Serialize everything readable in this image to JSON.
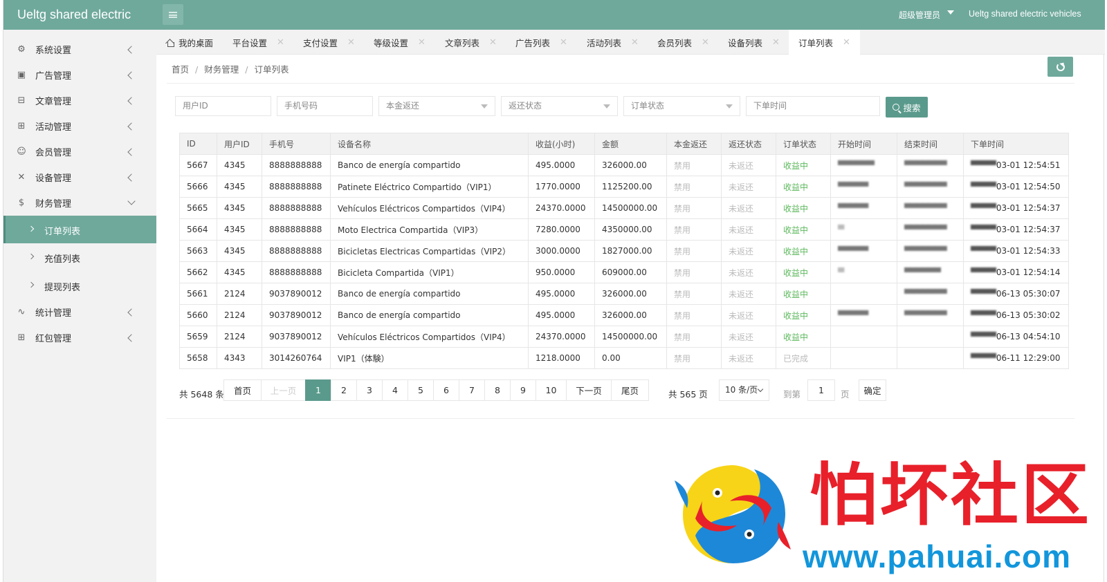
{
  "header": {
    "brand": "Ueltg shared electric",
    "admin": "超级管理员",
    "app_name": "Ueltg shared electric vehicles"
  },
  "sidebar": {
    "items": [
      {
        "label": "系统设置",
        "icon": "gear-icon"
      },
      {
        "label": "广告管理",
        "icon": "image-icon"
      },
      {
        "label": "文章管理",
        "icon": "book-icon"
      },
      {
        "label": "活动管理",
        "icon": "gift-icon"
      },
      {
        "label": "会员管理",
        "icon": "user-icon"
      },
      {
        "label": "设备管理",
        "icon": "tools-icon"
      },
      {
        "label": "财务管理",
        "icon": "dollar-icon"
      },
      {
        "label": "统计管理",
        "icon": "pulse-icon"
      },
      {
        "label": "红包管理",
        "icon": "gift-icon"
      }
    ],
    "finance_sub": [
      {
        "label": "订单列表"
      },
      {
        "label": "充值列表"
      },
      {
        "label": "提现列表"
      }
    ]
  },
  "tabs": [
    {
      "label": "我的桌面"
    },
    {
      "label": "平台设置"
    },
    {
      "label": "支付设置"
    },
    {
      "label": "等级设置"
    },
    {
      "label": "文章列表"
    },
    {
      "label": "广告列表"
    },
    {
      "label": "活动列表"
    },
    {
      "label": "会员列表"
    },
    {
      "label": "设备列表"
    },
    {
      "label": "订单列表"
    }
  ],
  "breadcrumb": [
    "首页",
    "财务管理",
    "订单列表"
  ],
  "filters": {
    "user_id": "用户ID",
    "phone": "手机号码",
    "principal_return": "本金返还",
    "return_status": "返还状态",
    "order_status": "订单状态",
    "order_time": "下单时间",
    "search_label": "搜索"
  },
  "table": {
    "columns": [
      "ID",
      "用户ID",
      "手机号",
      "设备名称",
      "收益(小时)",
      "金额",
      "本金返还",
      "返还状态",
      "订单状态",
      "开始时间",
      "结束时间",
      "下单时间"
    ],
    "rows": [
      {
        "id": "5667",
        "uid": "4345",
        "phone": "8888888888",
        "device": "Banco de energía compartido",
        "income": "495.0000",
        "amount": "326000.00",
        "principal": "禁用",
        "ret": "未返还",
        "status": "收益中",
        "start": "▀▀▀▀▀▀",
        "end": "▀▀▀▀▀▀▀",
        "ordered_mask": "▀▀▀▀",
        "ordered": "03-01 12:54:51"
      },
      {
        "id": "5666",
        "uid": "4345",
        "phone": "8888888888",
        "device": "Patinete Eléctrico Compartido（VIP1）",
        "income": "1770.0000",
        "amount": "1125200.00",
        "principal": "禁用",
        "ret": "未返还",
        "status": "收益中",
        "start": "▀▀▀▀▀",
        "end": "▀▀▀▀▀▀▀",
        "ordered_mask": "▀▀▀▀",
        "ordered": "03-01 12:54:50"
      },
      {
        "id": "5665",
        "uid": "4345",
        "phone": "8888888888",
        "device": "Vehículos Eléctricos Compartidos（VIP4）",
        "income": "24370.0000",
        "amount": "14500000.00",
        "principal": "禁用",
        "ret": "未返还",
        "status": "收益中",
        "start": "▀▀▀▀▀",
        "end": "▀▀▀▀▀▀▀",
        "ordered_mask": "▀▀▀▀",
        "ordered": "03-01 12:54:37"
      },
      {
        "id": "5664",
        "uid": "4345",
        "phone": "8888888888",
        "device": "Moto Electrica Compartida（VIP3）",
        "income": "7280.0000",
        "amount": "4350000.00",
        "principal": "禁用",
        "ret": "未返还",
        "status": "收益中",
        "start": "▀",
        "end": "▀▀▀▀▀▀▀",
        "ordered_mask": "▀▀▀▀",
        "ordered": "03-01 12:54:37"
      },
      {
        "id": "5663",
        "uid": "4345",
        "phone": "8888888888",
        "device": "Bicicletas Electricas Compartidas（VIP2）",
        "income": "3000.0000",
        "amount": "1827000.00",
        "principal": "禁用",
        "ret": "未返还",
        "status": "收益中",
        "start": "▀▀▀▀▀",
        "end": "▀▀▀▀▀▀▀",
        "ordered_mask": "▀▀▀▀",
        "ordered": "03-01 12:54:33"
      },
      {
        "id": "5662",
        "uid": "4345",
        "phone": "8888888888",
        "device": "Bicicleta Compartida（VIP1）",
        "income": "950.0000",
        "amount": "609000.00",
        "principal": "禁用",
        "ret": "未返还",
        "status": "收益中",
        "start": "▀",
        "end": "▀▀▀▀▀▀",
        "ordered_mask": "▀▀▀▀",
        "ordered": "03-01 12:54:14"
      },
      {
        "id": "5661",
        "uid": "2124",
        "phone": "9037890012",
        "device": "Banco de energía compartido",
        "income": "495.0000",
        "amount": "326000.00",
        "principal": "禁用",
        "ret": "未返还",
        "status": "收益中",
        "start": "",
        "end": "▀▀▀▀▀▀▀",
        "ordered_mask": "▀▀▀▀",
        "ordered": "06-13 05:30:07"
      },
      {
        "id": "5660",
        "uid": "2124",
        "phone": "9037890012",
        "device": "Banco de energía compartido",
        "income": "495.0000",
        "amount": "326000.00",
        "principal": "禁用",
        "ret": "未返还",
        "status": "收益中",
        "start": "▀▀▀▀▀",
        "end": "▀▀▀▀▀▀▀",
        "ordered_mask": "▀▀▀▀",
        "ordered": "06-13 05:30:02"
      },
      {
        "id": "5659",
        "uid": "2124",
        "phone": "9037890012",
        "device": "Vehículos Eléctricos Compartidos（VIP4）",
        "income": "24370.0000",
        "amount": "14500000.00",
        "principal": "禁用",
        "ret": "未返还",
        "status": "收益中",
        "start": "",
        "end": "",
        "ordered_mask": "▀▀▀▀",
        "ordered": "06-13 04:54:10"
      },
      {
        "id": "5658",
        "uid": "4343",
        "phone": "3014260764",
        "device": "VIP1（体験）",
        "income": "1218.0000",
        "amount": "0.00",
        "principal": "禁用",
        "ret": "未返还",
        "status": "已完成",
        "start": "",
        "end": "",
        "ordered_mask": "▀▀▀▀",
        "ordered": "06-11 12:29:00"
      }
    ]
  },
  "pagination": {
    "total": "共 5648 条",
    "first": "首页",
    "prev": "上一页",
    "pages": [
      "1",
      "2",
      "3",
      "4",
      "5",
      "6",
      "7",
      "8",
      "9",
      "10"
    ],
    "current": "1",
    "next": "下一页",
    "last": "尾页",
    "page_count": "共 565 页",
    "page_size": "10 条/页",
    "goto_label": "到第",
    "goto_value": "1",
    "page_label": "页",
    "confirm": "确定"
  },
  "watermark": {
    "text": "怕坏社区",
    "url": "www.pahuai.com"
  },
  "colors": {
    "primary": "#6fa99c",
    "primary_dark": "#5a9a8c",
    "running_status": "#5cb85c",
    "watermark_red": "#e8202a",
    "watermark_blue": "#1296db"
  }
}
